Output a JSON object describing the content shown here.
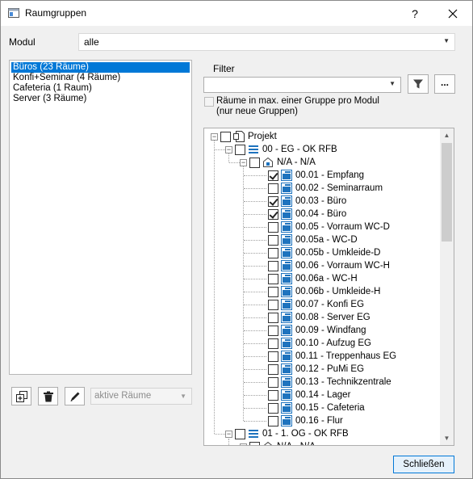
{
  "window": {
    "title": "Raumgruppen",
    "help": "?",
    "close": "✕"
  },
  "modul": {
    "label": "Modul",
    "value": "alle"
  },
  "groups": [
    {
      "label": "Büros (23 Räume)",
      "selected": true
    },
    {
      "label": "Konfi+Seminar (4 Räume)",
      "selected": false
    },
    {
      "label": "Cafeteria (1 Raum)",
      "selected": false
    },
    {
      "label": "Server (3 Räume)",
      "selected": false
    }
  ],
  "bottom": {
    "aktive_value": "aktive Räume"
  },
  "filter": {
    "label": "Filter",
    "value": "",
    "more_label": "...",
    "checkbox_label_1": "Räume in max. einer Gruppe pro Modul",
    "checkbox_label_2": "(nur neue Gruppen)"
  },
  "tree": {
    "project": "Projekt",
    "floor0": "00 - EG - OK RFB",
    "na": "N/A - N/A",
    "rooms": [
      {
        "label": "00.01 - Empfang",
        "checked": true
      },
      {
        "label": "00.02 - Seminarraum",
        "checked": false
      },
      {
        "label": "00.03 - Büro",
        "checked": true
      },
      {
        "label": "00.04 - Büro",
        "checked": true
      },
      {
        "label": "00.05 - Vorraum WC-D",
        "checked": false
      },
      {
        "label": "00.05a - WC-D",
        "checked": false
      },
      {
        "label": "00.05b - Umkleide-D",
        "checked": false
      },
      {
        "label": "00.06 - Vorraum WC-H",
        "checked": false
      },
      {
        "label": "00.06a - WC-H",
        "checked": false
      },
      {
        "label": "00.06b - Umkleide-H",
        "checked": false
      },
      {
        "label": "00.07 - Konfi EG",
        "checked": false
      },
      {
        "label": "00.08 - Server EG",
        "checked": false
      },
      {
        "label": "00.09 - Windfang",
        "checked": false
      },
      {
        "label": "00.10 - Aufzug EG",
        "checked": false
      },
      {
        "label": "00.11 - Treppenhaus EG",
        "checked": false
      },
      {
        "label": "00.12 - PuMi EG",
        "checked": false
      },
      {
        "label": "00.13 - Technikzentrale",
        "checked": false
      },
      {
        "label": "00.14 - Lager",
        "checked": false
      },
      {
        "label": "00.15 - Cafeteria",
        "checked": false
      },
      {
        "label": "00.16 - Flur",
        "checked": false
      }
    ],
    "floor1": "01 - 1. OG - OK RFB",
    "na2": "N/A - N/A"
  },
  "footer": {
    "close_label": "Schließen"
  },
  "colors": {
    "accent": "#0078d7",
    "room_icon": "#1e73be",
    "floor_icon": "#1e73be"
  }
}
